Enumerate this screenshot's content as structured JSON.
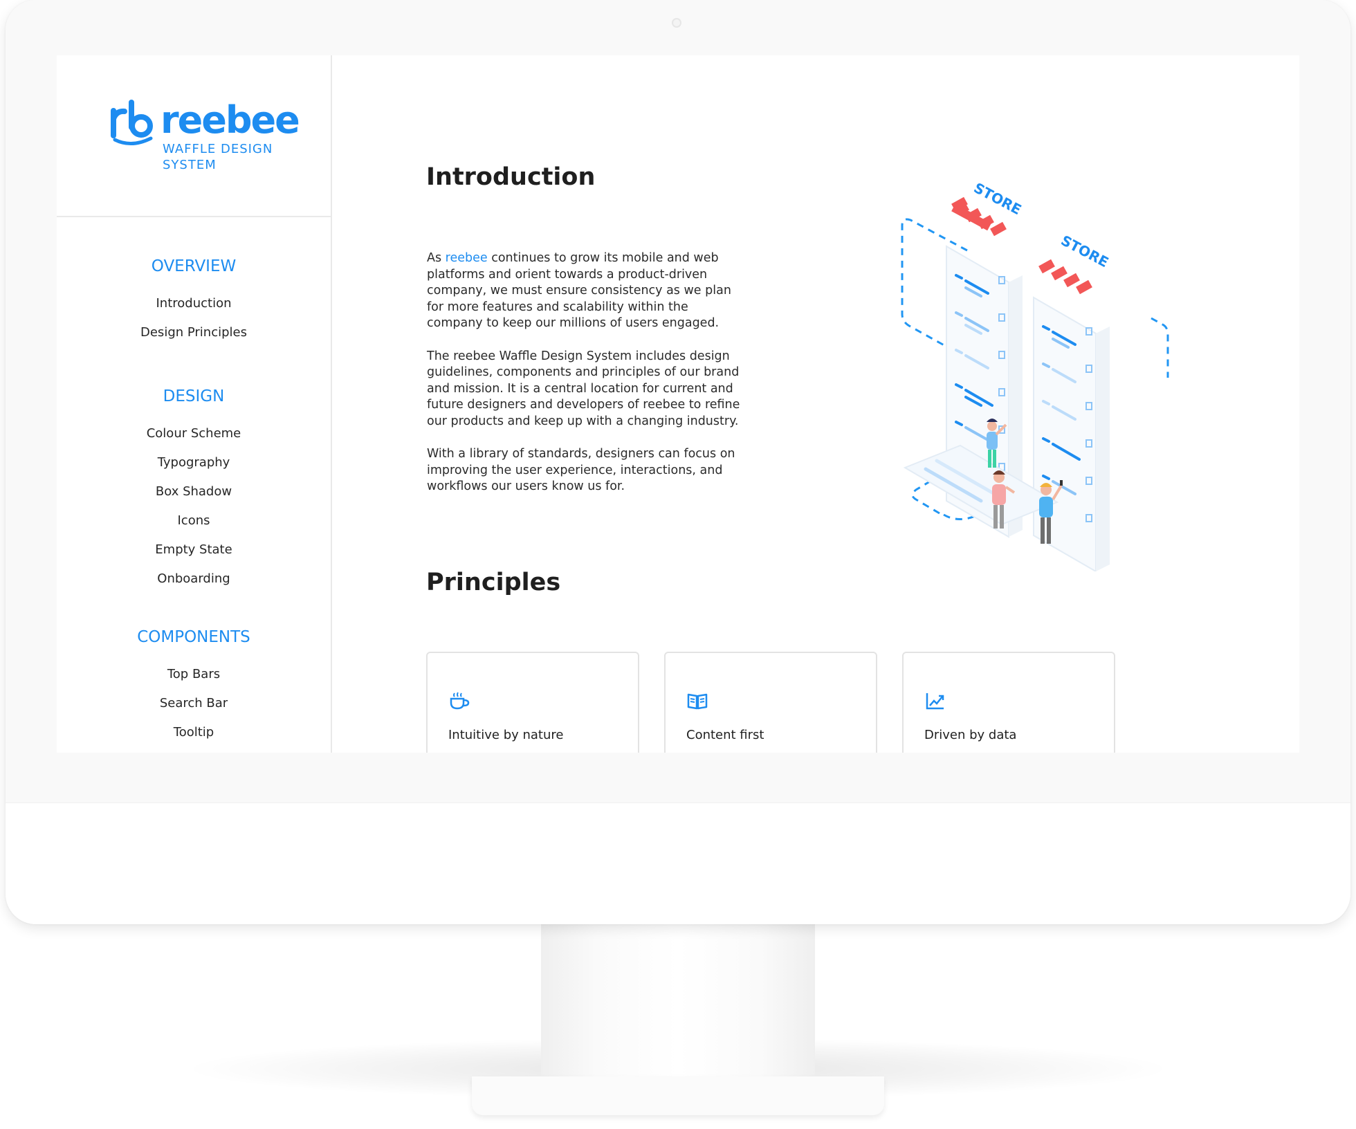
{
  "brand": {
    "name": "reebee",
    "subtitle": "WAFFLE DESIGN SYSTEM",
    "accent_color": "#1d8cf0"
  },
  "sidebar": {
    "sections": [
      {
        "heading": "OVERVIEW",
        "items": [
          "Introduction",
          "Design Principles"
        ]
      },
      {
        "heading": "DESIGN",
        "items": [
          "Colour Scheme",
          "Typography",
          "Box Shadow",
          "Icons",
          "Empty State",
          "Onboarding"
        ]
      },
      {
        "heading": "COMPONENTS",
        "items": [
          "Top Bars",
          "Search Bar",
          "Tooltip"
        ]
      }
    ]
  },
  "main": {
    "intro_title": "Introduction",
    "intro_p1_pre": "As ",
    "intro_p1_link": "reebee",
    "intro_p1_post": " continues to grow its mobile and web platforms and orient towards a product-driven company, we must ensure consistency as we plan for more features and scalability within the company to keep our millions of users engaged.",
    "intro_p2": "The reebee Waffle Design System includes design guidelines, components and principles of our brand and mission. It is a central location for current and future designers and developers of reebee to refine our products and keep up with a changing industry.",
    "intro_p3": "With a library of standards, designers can focus on improving the user experience, interactions, and workflows our users know us for.",
    "illustration": {
      "sign_left": "STORE",
      "sign_right": "STORE",
      "awning_color": "#f25757"
    },
    "principles_title": "Principles",
    "principles": [
      {
        "title": "Intuitive by nature",
        "icon": "coffee-cup-icon"
      },
      {
        "title": "Content first",
        "icon": "open-book-icon"
      },
      {
        "title": "Driven by data",
        "icon": "trending-chart-icon"
      }
    ]
  }
}
